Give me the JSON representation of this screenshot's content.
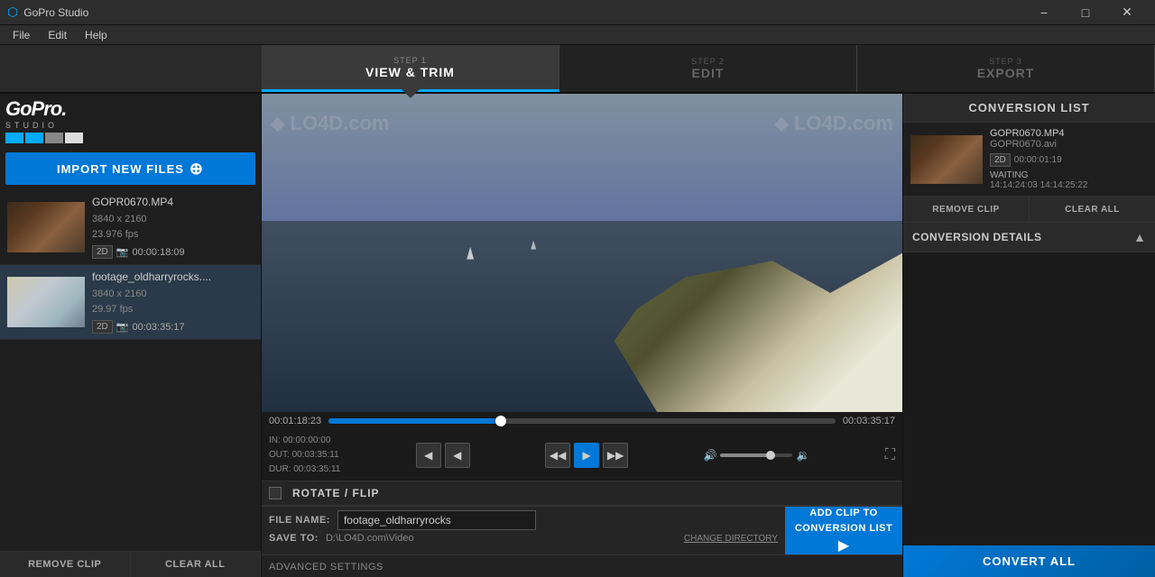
{
  "titlebar": {
    "title": "GoPro Studio",
    "icon": "gopro-icon",
    "min_label": "−",
    "max_label": "□",
    "close_label": "✕"
  },
  "menubar": {
    "items": [
      "File",
      "Edit",
      "Help"
    ]
  },
  "steps": [
    {
      "number": "STEP 1",
      "label": "VIEW & TRIM",
      "active": true
    },
    {
      "number": "STEP 2",
      "label": "EDIT",
      "active": false
    },
    {
      "number": "STEP 3",
      "label": "EXPORT",
      "active": false
    }
  ],
  "logo": {
    "brand": "GoPro.",
    "sub": "STUDIO"
  },
  "left_panel": {
    "import_btn": "IMPORT NEW FILES",
    "clips": [
      {
        "name": "GOPR0670.MP4",
        "resolution": "3840 x 2160",
        "fps": "23.976 fps",
        "duration": "00:00:18:09",
        "badge": "2D"
      },
      {
        "name": "footage_oldharryrocks....",
        "resolution": "3840 x 2160",
        "fps": "29.97 fps",
        "duration": "00:03:35:17",
        "badge": "2D"
      }
    ],
    "remove_clip_btn": "REMOVE CLIP",
    "clear_all_btn": "CLEAR ALL"
  },
  "video": {
    "watermark": "⬥ LO4D.com",
    "time_current": "00:01:18:23",
    "time_total": "00:03:35:17",
    "progress_pct": 34,
    "in_point": "00:00:00:00",
    "out_point": "00:03:35:11",
    "duration": "00:03:35:11"
  },
  "transport": {
    "step_back_btn": "◀◀",
    "play_btn": "▶",
    "step_fwd_btn": "▶▶"
  },
  "bottom_controls": {
    "rotate_flip_label": "ROTATE / FLIP",
    "filename_label": "FILE NAME:",
    "filename_value": "footage_oldharryrocks",
    "saveto_label": "SAVE TO:",
    "saveto_path": "D:\\LO4D.com\\Video",
    "change_dir": "CHANGE DIRECTORY",
    "add_clip_btn_line1": "ADD CLIP TO",
    "add_clip_btn_line2": "CONVERSION LIST",
    "advanced_settings_btn": "ADVANCED SETTINGS"
  },
  "right_panel": {
    "conversion_list_title": "CONVERSION LIST",
    "conv_items": [
      {
        "name1": "GOPR0670.MP4",
        "name2": "GOPR0670.avi",
        "badge": "2D",
        "duration": "00:00:01:19",
        "status": "WAITING",
        "time": "14:14:24:03   14:14:25:22"
      }
    ],
    "remove_clip_btn": "REMOVE CLIP",
    "clear_btn": "CLEAR ALL",
    "conversion_details_label": "CONVERSION DETAILS",
    "convert_all_btn": "CONVERT ALL"
  }
}
